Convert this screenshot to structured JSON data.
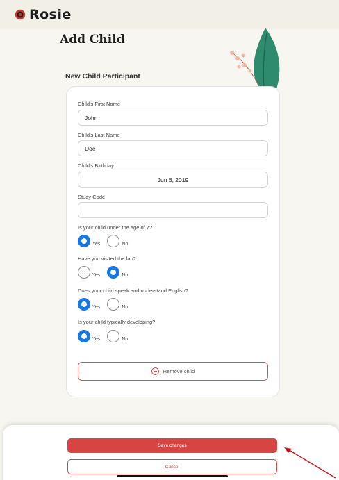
{
  "app": {
    "name": "Rosie",
    "accent": "#d64541",
    "radio_color": "#1478e6"
  },
  "page": {
    "title": "Add Child",
    "section_title": "New Child Participant"
  },
  "form": {
    "first_name": {
      "label": "Child's First Name",
      "value": "John"
    },
    "last_name": {
      "label": "Child's Last Name",
      "value": "Doe"
    },
    "birthday": {
      "label": "Child's Birthday",
      "value": "Jun 6, 2019"
    },
    "study_code": {
      "label": "Study Code",
      "value": ""
    },
    "questions": [
      {
        "label": "Is your child under the age of 7?",
        "yes": "Yes",
        "no": "No",
        "selected": "Yes"
      },
      {
        "label": "Have you visited the lab?",
        "yes": "Yes",
        "no": "No",
        "selected": "No"
      },
      {
        "label": "Does your child speak and understand English?",
        "yes": "Yes",
        "no": "No",
        "selected": "Yes"
      },
      {
        "label": "Is your child typically developing?",
        "yes": "Yes",
        "no": "No",
        "selected": "Yes"
      }
    ],
    "remove_label": "Remove child"
  },
  "footer": {
    "save_label": "Save changes",
    "cancel_label": "Cancel"
  }
}
